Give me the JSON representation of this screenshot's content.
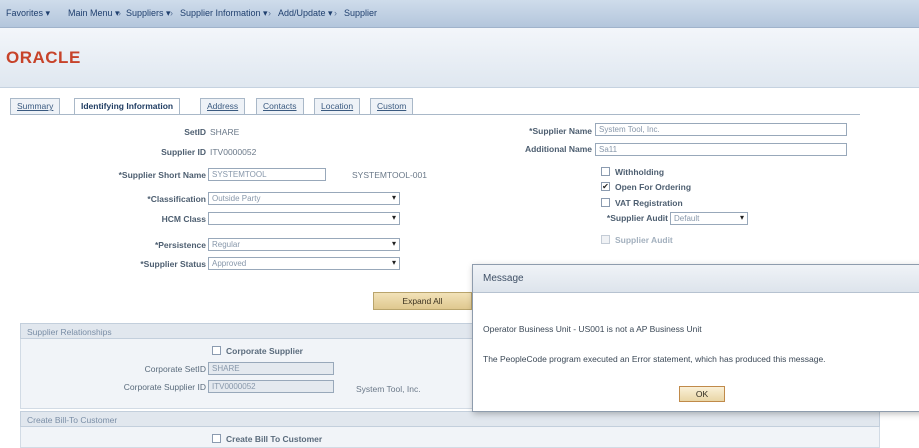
{
  "nav": {
    "favorites": "Favorites",
    "main_menu": "Main Menu",
    "crumbs": [
      "Suppliers",
      "Supplier Information",
      "Add/Update",
      "Supplier"
    ]
  },
  "brand": {
    "logo": "ORACLE",
    "logo_color": "#c7432a"
  },
  "tabs": [
    "Summary",
    "Identifying Information",
    "Address",
    "Contacts",
    "Location",
    "Custom"
  ],
  "form": {
    "setid_label": "SetID",
    "setid_value": "SHARE",
    "supplier_id_label": "Supplier ID",
    "supplier_id_value": "ITV0000052",
    "short_name_label": "*Supplier Short Name",
    "short_name_value": "SYSTEMTOOL",
    "short_name_suffix": "SYSTEMTOOL-001",
    "classification_label": "*Classification",
    "classification_value": "Outside Party",
    "hcm_label": "HCM Class",
    "hcm_value": "",
    "persistence_label": "*Persistence",
    "persistence_value": "Regular",
    "status_label": "*Supplier Status",
    "status_value": "Approved",
    "supplier_name_label": "*Supplier Name",
    "supplier_name_value": "System Tool, Inc.",
    "additional_name_label": "Additional Name",
    "additional_name_value": "Sa11",
    "withholding_label": "Withholding",
    "withholding_checked": false,
    "open_for_ordering_label": "Open For Ordering",
    "open_for_ordering_checked": true,
    "vat_label": "VAT Registration",
    "vat_checked": false,
    "audit_label": "*Supplier Audit",
    "audit_value": "Default",
    "audit_check_label": "Supplier Audit",
    "audit_check_checked": false,
    "expand_all": "Expand All"
  },
  "relationships": {
    "header": "Supplier Relationships",
    "corporate_supplier_label": "Corporate Supplier",
    "corp_setid_label": "Corporate SetID",
    "corp_setid_value": "SHARE",
    "corp_supplier_id_label": "Corporate Supplier ID",
    "corp_supplier_id_value": "ITV0000052",
    "corp_supplier_name": "System Tool, Inc."
  },
  "bill_to": {
    "header": "Create Bill-To Customer",
    "checkbox_label": "Create Bill To Customer"
  },
  "modal": {
    "title": "Message",
    "line1": "Operator Business Unit - US001 is not a AP Business Unit",
    "line2": "The PeopleCode program executed an Error statement, which has produced this message.",
    "ok_label": "OK"
  }
}
